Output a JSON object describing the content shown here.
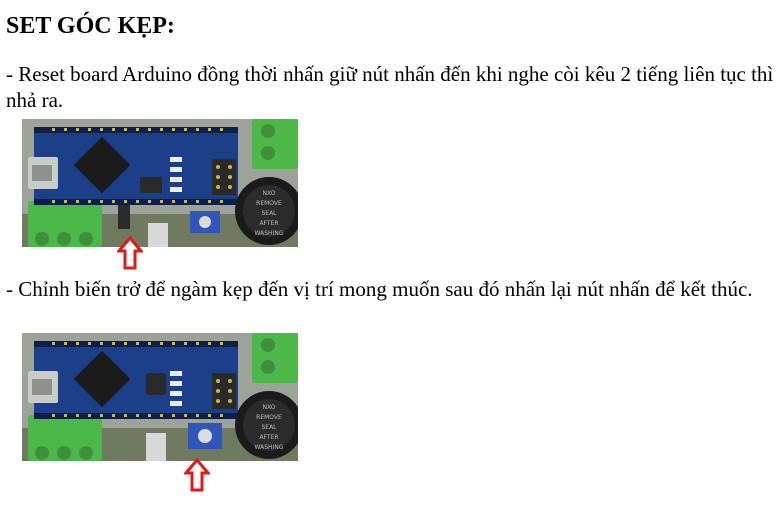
{
  "title": "SET GÓC KẸP:",
  "steps": [
    {
      "text": "- Reset board Arduino đồng thời nhấn giữ nút nhấn đến khi nghe còi kêu 2 tiếng liên tục thì nhả ra.",
      "photo_name": "arduino-nano-board-photo",
      "arrow_target": "reset-button"
    },
    {
      "text": "- Chỉnh biến trở để ngàm kẹp đến vị trí mong muốn sau đó nhấn lại nút nhấn để kết thúc.",
      "photo_name": "arduino-nano-board-photo",
      "arrow_target": "potentiometer"
    }
  ],
  "colors": {
    "pcb": "#1c3f8a",
    "terminal": "#4cb84a",
    "arrow": "#e11919",
    "trimpot": "#2f56b8"
  }
}
